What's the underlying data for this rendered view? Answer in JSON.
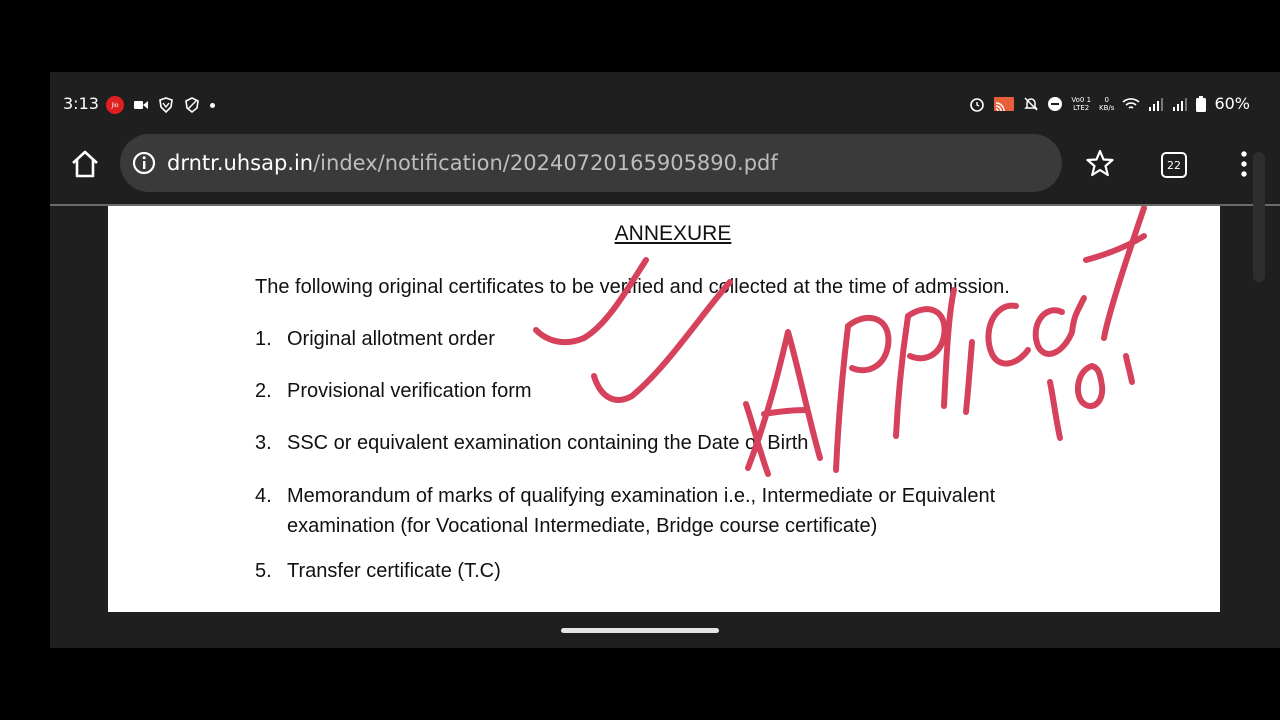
{
  "status": {
    "time": "3:13",
    "right_tiny_1": [
      "Vo0 1",
      "LTE2"
    ],
    "right_tiny_2": [
      "0",
      "KB/s"
    ],
    "battery": "60%"
  },
  "browser": {
    "url_host": "drntr.uhsap.in",
    "url_path": "/index/notification/20240720165905890.pdf",
    "tab_count": "22"
  },
  "document": {
    "title": "ANNEXURE",
    "intro": "The following original certificates to be verified and collected at the time of admission.",
    "items": [
      {
        "num": "1.",
        "text": "Original allotment order"
      },
      {
        "num": "2.",
        "text": "Provisional verification form"
      },
      {
        "num": "3.",
        "text": "SSC or equivalent examination containing the Date of Birth"
      },
      {
        "num": "4.",
        "text": "Memorandum of marks of qualifying examination i.e., Intermediate or Equivalent examination (for Vocational Intermediate, Bridge course certificate)"
      },
      {
        "num": "5.",
        "text": "Transfer certificate (T.C)"
      }
    ]
  },
  "annotation": {
    "handwritten_text": "Applicat ion",
    "ink_color": "#d6415c"
  }
}
